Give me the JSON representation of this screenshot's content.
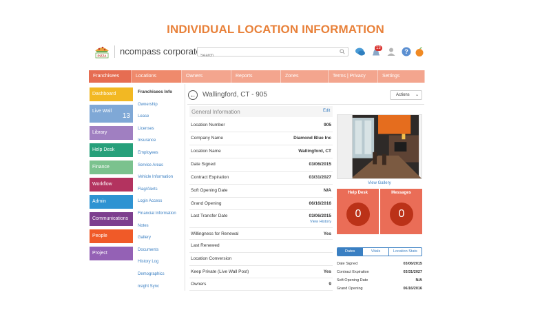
{
  "slide_title": "INDIVIDUAL LOCATION INFORMATION",
  "header": {
    "logo_icon": "pizza-logo-icon",
    "app_name": "ncompass corporate",
    "search_placeholder": "Search",
    "notification_count": "13",
    "icons": [
      "chat-icon",
      "bell-icon",
      "user-icon",
      "help-icon",
      "profile-fruit-icon"
    ]
  },
  "topnav": [
    {
      "label": "Franchisees",
      "color": "#e66d52",
      "width": 62
    },
    {
      "label": "Locations",
      "color": "#ef8a6c",
      "width": 73
    },
    {
      "label": "Owners",
      "color": "#f3a58e",
      "width": 72
    },
    {
      "label": "Reports",
      "color": "#f3a58e",
      "width": 72
    },
    {
      "label": "Zones",
      "color": "#f3a58e",
      "width": 69
    },
    {
      "label": "Terms | Privacy",
      "color": "#f3a58e",
      "width": 72
    },
    {
      "label": "Settings",
      "color": "#f3a58e",
      "width": 68
    }
  ],
  "leftmenu": [
    {
      "label": "Dashboard",
      "color": "#f2b823"
    },
    {
      "label": "Live Wall",
      "color": "#7fa8d6",
      "count": "13"
    },
    {
      "label": "Library",
      "color": "#a07fc1"
    },
    {
      "label": "Help Desk",
      "color": "#26a07a"
    },
    {
      "label": "Finance",
      "color": "#7bc28e"
    },
    {
      "label": "Workflow",
      "color": "#b3335f"
    },
    {
      "label": "Admin",
      "color": "#2e93d2"
    },
    {
      "label": "Communications",
      "color": "#7d3f8e"
    },
    {
      "label": "People",
      "color": "#f05a28"
    },
    {
      "label": "Project",
      "color": "#9461b5"
    }
  ],
  "submenu": [
    "Franchisees Info",
    "Ownership",
    "Lease",
    "Licenses",
    "Insurance",
    "Employees",
    "Service Areas",
    "Vehicle Information",
    "Flag/Alerts",
    "Login Access",
    "Financial Information",
    "Notes",
    "Gallery",
    "Documents",
    "History Log",
    "Demographics",
    "nsight Sync"
  ],
  "location": {
    "title": "Wallingford, CT - 905",
    "actions_label": "Actions"
  },
  "general": {
    "title": "General Information",
    "edit_label": "Edit",
    "rows": [
      {
        "label": "Location Number",
        "value": "905"
      },
      {
        "label": "Company Name",
        "value": "Diamond Blue Inc"
      },
      {
        "label": "Location Name",
        "value": "Wallingford, CT"
      },
      {
        "label": "Date Signed",
        "value": "03/06/2015"
      },
      {
        "label": "Contract Expiration",
        "value": "03/31/2027"
      },
      {
        "label": "Soft Opening Date",
        "value": "N/A"
      },
      {
        "label": "Grand Opening",
        "value": "06/16/2016"
      },
      {
        "label": "Last Transfer Date",
        "value": "03/06/2015",
        "link": "View History"
      },
      {
        "label": "Willingness for Renewal",
        "value": "Yes"
      },
      {
        "label": "Last Renewed",
        "value": ""
      },
      {
        "label": "Location Conversion",
        "value": ""
      },
      {
        "label": "Keep Private (Live Wall Post)",
        "value": "Yes"
      },
      {
        "label": "Owners",
        "value": "9"
      }
    ]
  },
  "gallery_link": "View Gallery",
  "tiles": [
    {
      "title": "Help Desk",
      "count": "0"
    },
    {
      "title": "Messages",
      "count": "0"
    }
  ],
  "tabs": [
    "Dates",
    "Vitals",
    "Location Stats"
  ],
  "dates": [
    {
      "label": "Date Signed",
      "value": "03/06/2015"
    },
    {
      "label": "Contract Expiration",
      "value": "03/31/2027"
    },
    {
      "label": "Soft Opening Date",
      "value": "N/A"
    },
    {
      "label": "Grand Opening",
      "value": "06/16/2016"
    }
  ]
}
